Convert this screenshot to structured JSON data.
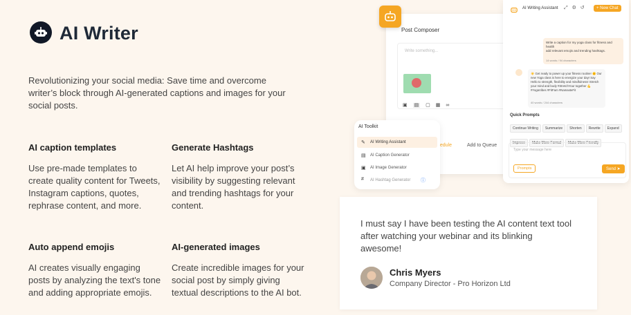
{
  "brand": {
    "name": "AI Writer",
    "logo_icon": "robot-icon"
  },
  "intro": "Revolutionizing your social media: Save time and overcome writer’s block through AI-generated captions and images for your social posts.",
  "features": [
    {
      "title": "AI caption templates",
      "text": "Use pre-made templates to create quality content for Tweets, Instagram captions, quotes, rephrase content, and more."
    },
    {
      "title": "Generate Hashtags",
      "text": "Let AI help improve your post’s visibility by suggesting relevant and trending hashtags for your content."
    },
    {
      "title": "Auto append emojis",
      "text": "AI creates visually engaging posts by analyzing the text's tone and adding appropriate emojis."
    },
    {
      "title": "AI-generated images",
      "text": "Create incredible images for your social post by simply giving textual descriptions to the AI bot."
    }
  ],
  "composer": {
    "title": "Post Composer",
    "placeholder": "Write something...",
    "schedule_label": "hedule",
    "queue_label": "Add to Queue"
  },
  "toolkit": {
    "title": "AI Toolkit",
    "items": [
      "AI Writing Assistant",
      "AI Caption Generator",
      "AI Image Generator",
      "AI Hashtag Generator"
    ]
  },
  "assistant": {
    "title": "AI Writing Assistant",
    "new_chat": "+ New Chat",
    "user_message": "Write a caption for my yoga class for fitness and health\nadd relevant emojis and trending hashtags.",
    "user_meta": "14 words / 94 characters",
    "ai_message": "☀️ Get ready to power up your fitness routine! 🌞 Our new Yoga class is here to energize your day! Say Hello to strength, flexibility and mindfulness! Stretch your mind and body #StretchYour together 💪 #YogaVibes #FitFam #NamasteFit",
    "ai_meta": "40 words / 244 characters",
    "quick_prompts_title": "Quick Prompts",
    "quick_prompts": [
      "Continue Writing",
      "Summarize",
      "Shorten",
      "Rewrite",
      "Expand",
      "Improve",
      "Make More Formal",
      "Make More Friendly"
    ],
    "input_placeholder": "Type your message here",
    "prompts_button": "Prompts",
    "send_button": "Send"
  },
  "testimonial": {
    "quote": "I must say I have been testing the AI content text tool after watching your webinar and its blinking awesome!",
    "name": "Chris Myers",
    "role": "Company Director - Pro Horizon Ltd"
  },
  "colors": {
    "accent": "#f5a623",
    "background": "#fdf6ee",
    "dark": "#111827"
  }
}
